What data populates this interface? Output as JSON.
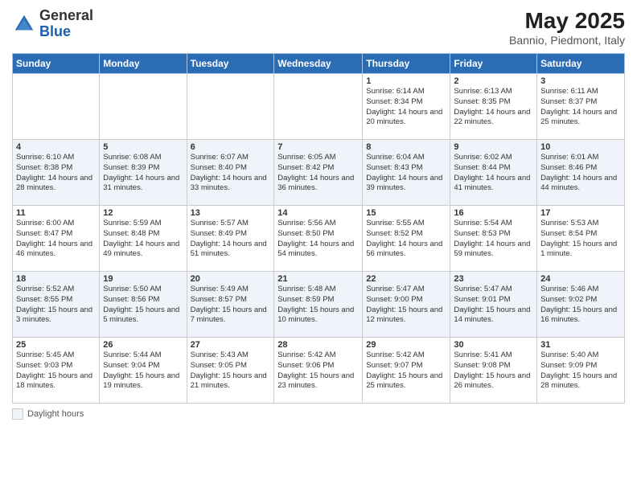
{
  "logo": {
    "general": "General",
    "blue": "Blue"
  },
  "title": "May 2025",
  "location": "Bannio, Piedmont, Italy",
  "days_of_week": [
    "Sunday",
    "Monday",
    "Tuesday",
    "Wednesday",
    "Thursday",
    "Friday",
    "Saturday"
  ],
  "legend_label": "Daylight hours",
  "weeks": [
    [
      {
        "day": "",
        "info": ""
      },
      {
        "day": "",
        "info": ""
      },
      {
        "day": "",
        "info": ""
      },
      {
        "day": "",
        "info": ""
      },
      {
        "day": "1",
        "info": "Sunrise: 6:14 AM\nSunset: 8:34 PM\nDaylight: 14 hours and 20 minutes."
      },
      {
        "day": "2",
        "info": "Sunrise: 6:13 AM\nSunset: 8:35 PM\nDaylight: 14 hours and 22 minutes."
      },
      {
        "day": "3",
        "info": "Sunrise: 6:11 AM\nSunset: 8:37 PM\nDaylight: 14 hours and 25 minutes."
      }
    ],
    [
      {
        "day": "4",
        "info": "Sunrise: 6:10 AM\nSunset: 8:38 PM\nDaylight: 14 hours and 28 minutes."
      },
      {
        "day": "5",
        "info": "Sunrise: 6:08 AM\nSunset: 8:39 PM\nDaylight: 14 hours and 31 minutes."
      },
      {
        "day": "6",
        "info": "Sunrise: 6:07 AM\nSunset: 8:40 PM\nDaylight: 14 hours and 33 minutes."
      },
      {
        "day": "7",
        "info": "Sunrise: 6:05 AM\nSunset: 8:42 PM\nDaylight: 14 hours and 36 minutes."
      },
      {
        "day": "8",
        "info": "Sunrise: 6:04 AM\nSunset: 8:43 PM\nDaylight: 14 hours and 39 minutes."
      },
      {
        "day": "9",
        "info": "Sunrise: 6:02 AM\nSunset: 8:44 PM\nDaylight: 14 hours and 41 minutes."
      },
      {
        "day": "10",
        "info": "Sunrise: 6:01 AM\nSunset: 8:46 PM\nDaylight: 14 hours and 44 minutes."
      }
    ],
    [
      {
        "day": "11",
        "info": "Sunrise: 6:00 AM\nSunset: 8:47 PM\nDaylight: 14 hours and 46 minutes."
      },
      {
        "day": "12",
        "info": "Sunrise: 5:59 AM\nSunset: 8:48 PM\nDaylight: 14 hours and 49 minutes."
      },
      {
        "day": "13",
        "info": "Sunrise: 5:57 AM\nSunset: 8:49 PM\nDaylight: 14 hours and 51 minutes."
      },
      {
        "day": "14",
        "info": "Sunrise: 5:56 AM\nSunset: 8:50 PM\nDaylight: 14 hours and 54 minutes."
      },
      {
        "day": "15",
        "info": "Sunrise: 5:55 AM\nSunset: 8:52 PM\nDaylight: 14 hours and 56 minutes."
      },
      {
        "day": "16",
        "info": "Sunrise: 5:54 AM\nSunset: 8:53 PM\nDaylight: 14 hours and 59 minutes."
      },
      {
        "day": "17",
        "info": "Sunrise: 5:53 AM\nSunset: 8:54 PM\nDaylight: 15 hours and 1 minute."
      }
    ],
    [
      {
        "day": "18",
        "info": "Sunrise: 5:52 AM\nSunset: 8:55 PM\nDaylight: 15 hours and 3 minutes."
      },
      {
        "day": "19",
        "info": "Sunrise: 5:50 AM\nSunset: 8:56 PM\nDaylight: 15 hours and 5 minutes."
      },
      {
        "day": "20",
        "info": "Sunrise: 5:49 AM\nSunset: 8:57 PM\nDaylight: 15 hours and 7 minutes."
      },
      {
        "day": "21",
        "info": "Sunrise: 5:48 AM\nSunset: 8:59 PM\nDaylight: 15 hours and 10 minutes."
      },
      {
        "day": "22",
        "info": "Sunrise: 5:47 AM\nSunset: 9:00 PM\nDaylight: 15 hours and 12 minutes."
      },
      {
        "day": "23",
        "info": "Sunrise: 5:47 AM\nSunset: 9:01 PM\nDaylight: 15 hours and 14 minutes."
      },
      {
        "day": "24",
        "info": "Sunrise: 5:46 AM\nSunset: 9:02 PM\nDaylight: 15 hours and 16 minutes."
      }
    ],
    [
      {
        "day": "25",
        "info": "Sunrise: 5:45 AM\nSunset: 9:03 PM\nDaylight: 15 hours and 18 minutes."
      },
      {
        "day": "26",
        "info": "Sunrise: 5:44 AM\nSunset: 9:04 PM\nDaylight: 15 hours and 19 minutes."
      },
      {
        "day": "27",
        "info": "Sunrise: 5:43 AM\nSunset: 9:05 PM\nDaylight: 15 hours and 21 minutes."
      },
      {
        "day": "28",
        "info": "Sunrise: 5:42 AM\nSunset: 9:06 PM\nDaylight: 15 hours and 23 minutes."
      },
      {
        "day": "29",
        "info": "Sunrise: 5:42 AM\nSunset: 9:07 PM\nDaylight: 15 hours and 25 minutes."
      },
      {
        "day": "30",
        "info": "Sunrise: 5:41 AM\nSunset: 9:08 PM\nDaylight: 15 hours and 26 minutes."
      },
      {
        "day": "31",
        "info": "Sunrise: 5:40 AM\nSunset: 9:09 PM\nDaylight: 15 hours and 28 minutes."
      }
    ]
  ]
}
